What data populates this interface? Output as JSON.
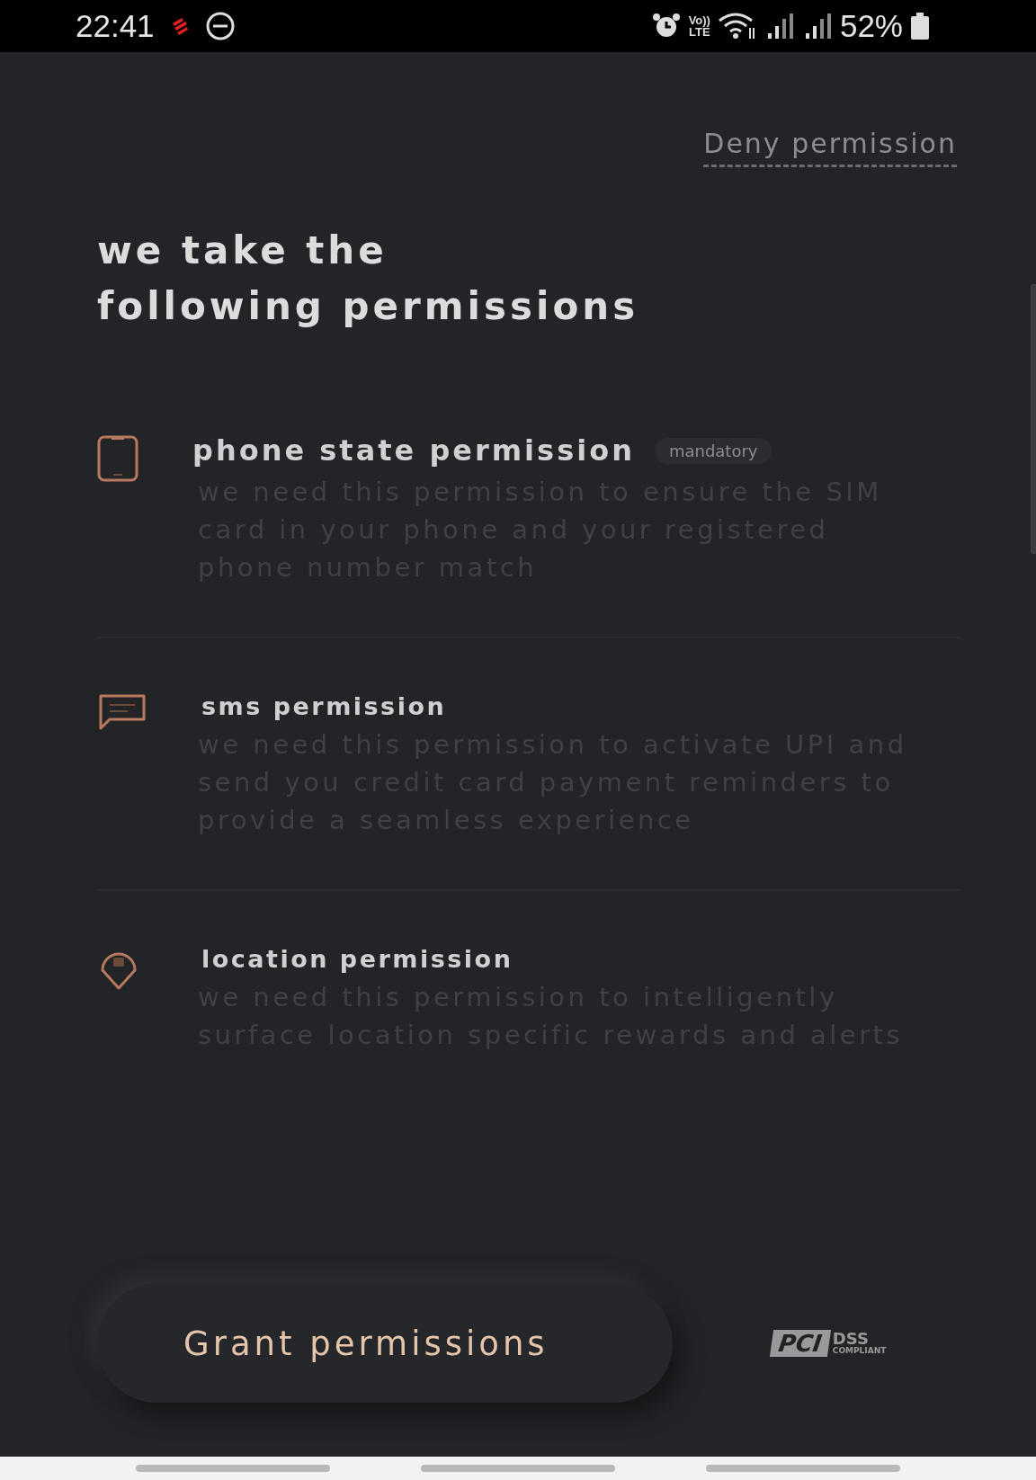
{
  "status_bar": {
    "time": "22:41",
    "battery": "52%",
    "network": "Vo))\nLTE"
  },
  "deny_link": "Deny permission",
  "heading": [
    "we take the",
    "following permissions"
  ],
  "permissions": [
    {
      "kind": "phone",
      "title": "phone state permission",
      "badge": "mandatory",
      "description": "we need this permission to ensure the SIM card in your phone and your registered phone number match"
    },
    {
      "kind": "sms",
      "title": "sms permission",
      "description": "we need this permission to activate UPI and send you credit card payment reminders to provide a seamless experience"
    },
    {
      "kind": "location",
      "title": "location permission",
      "description": "we need this permission to intelligently surface location specific rewards and alerts"
    }
  ],
  "grant_button": "Grant permissions",
  "compliance_logo": {
    "mark": "PCI",
    "name": "DSS",
    "caption": "COMPLIANT"
  }
}
